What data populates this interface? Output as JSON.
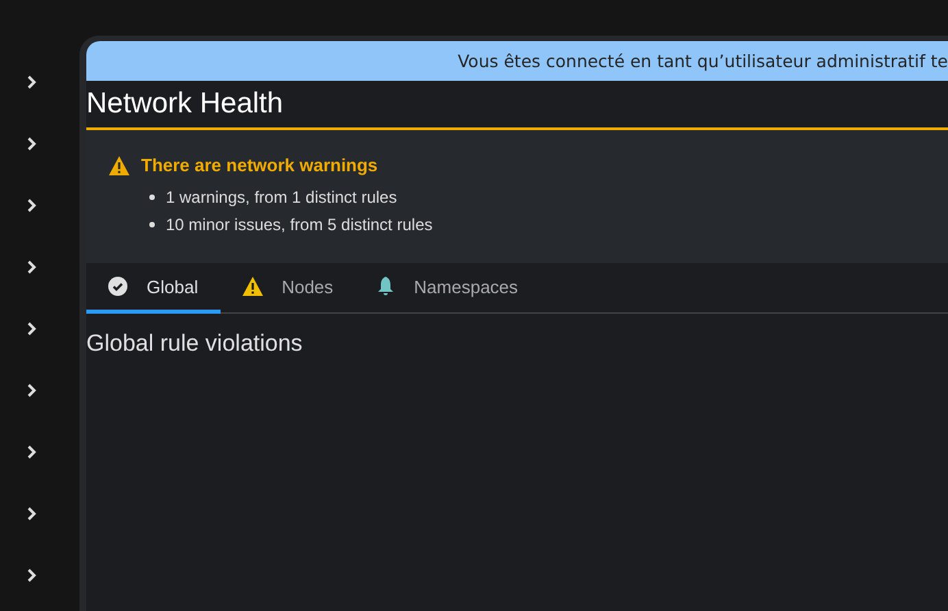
{
  "sidebar": {
    "items": [
      {
        "expanded": false
      },
      {
        "expanded": false
      },
      {
        "expanded": false
      },
      {
        "expanded": false
      },
      {
        "expanded": false
      },
      {
        "expanded": false
      },
      {
        "expanded": false
      },
      {
        "expanded": false
      },
      {
        "expanded": false
      }
    ]
  },
  "banner": {
    "text": "Vous êtes connecté en tant qu’utilisateur administratif te"
  },
  "page": {
    "title": "Network Health"
  },
  "alert": {
    "title": "There are network warnings",
    "items": [
      "1 warnings, from 1 distinct rules",
      "10 minor issues, from 5 distinct rules"
    ]
  },
  "tabs": [
    {
      "label": "Global",
      "kind": "check",
      "selected": true
    },
    {
      "label": "Nodes",
      "kind": "warning",
      "selected": false
    },
    {
      "label": "Namespaces",
      "kind": "bell",
      "selected": false
    }
  ],
  "section": {
    "title": "Global rule violations"
  }
}
